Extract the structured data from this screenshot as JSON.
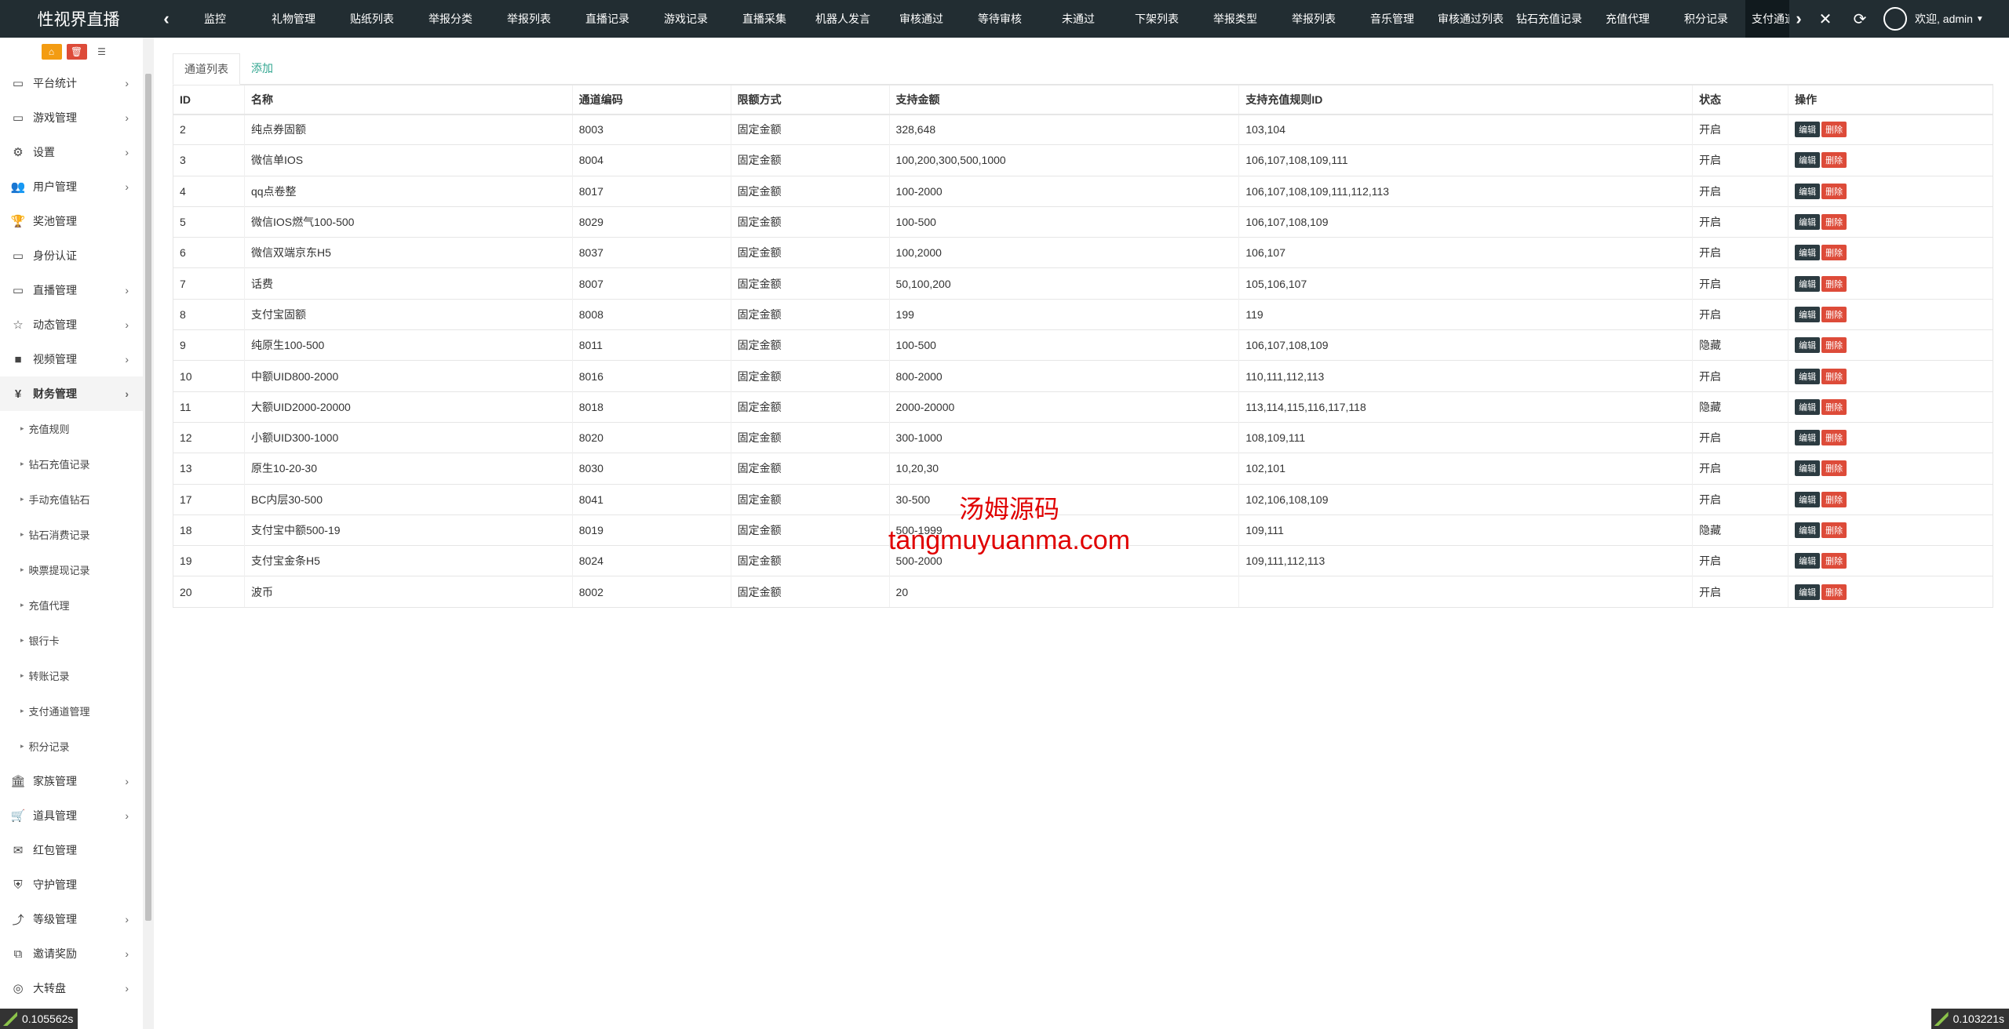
{
  "topbar": {
    "brand": "性视界直播",
    "tabs": [
      "监控",
      "礼物管理",
      "贴纸列表",
      "举报分类",
      "举报列表",
      "直播记录",
      "游戏记录",
      "直播采集",
      "机器人发言",
      "审核通过",
      "等待审核",
      "未通过",
      "下架列表",
      "举报类型",
      "举报列表",
      "音乐管理",
      "审核通过列表",
      "钻石充值记录",
      "充值代理",
      "积分记录",
      "支付通道管理"
    ],
    "active_tab_index": 20,
    "welcome": "欢迎, admin"
  },
  "sidebar": {
    "items": [
      {
        "label": "平台统计",
        "icon": "monitor-icon",
        "glyph": "▭",
        "chev": true
      },
      {
        "label": "游戏管理",
        "icon": "monitor-icon",
        "glyph": "▭",
        "chev": true
      },
      {
        "label": "设置",
        "icon": "cogs-icon",
        "glyph": "⚙",
        "chev": true
      },
      {
        "label": "用户管理",
        "icon": "users-icon",
        "glyph": "👥",
        "chev": true
      },
      {
        "label": "奖池管理",
        "icon": "trophy-icon",
        "glyph": "🏆",
        "chev": false
      },
      {
        "label": "身份认证",
        "icon": "monitor-icon",
        "glyph": "▭",
        "chev": false
      },
      {
        "label": "直播管理",
        "icon": "monitor-icon",
        "glyph": "▭",
        "chev": true
      },
      {
        "label": "动态管理",
        "icon": "star-icon",
        "glyph": "☆",
        "chev": true
      },
      {
        "label": "视频管理",
        "icon": "video-icon",
        "glyph": "■",
        "chev": true
      },
      {
        "label": "财务管理",
        "icon": "yen-icon",
        "glyph": "¥",
        "chev": true,
        "expanded": true
      }
    ],
    "sub_items": [
      "充值规则",
      "钻石充值记录",
      "手动充值钻石",
      "钻石消费记录",
      "映票提现记录",
      "充值代理",
      "银行卡",
      "转账记录",
      "支付通道管理",
      "积分记录"
    ],
    "items_after": [
      {
        "label": "家族管理",
        "icon": "bank-icon",
        "glyph": "🏛",
        "chev": true
      },
      {
        "label": "道具管理",
        "icon": "cart-icon",
        "glyph": "🛒",
        "chev": true
      },
      {
        "label": "红包管理",
        "icon": "envelope-icon",
        "glyph": "✉",
        "chev": false
      },
      {
        "label": "守护管理",
        "icon": "shield-icon",
        "glyph": "⛨",
        "chev": false
      },
      {
        "label": "等级管理",
        "icon": "level-icon",
        "glyph": "⤴",
        "chev": true
      },
      {
        "label": "邀请奖励",
        "icon": "sitemap-icon",
        "glyph": "⧉",
        "chev": true
      },
      {
        "label": "大转盘",
        "icon": "gamepad-icon",
        "glyph": "◎",
        "chev": true
      }
    ]
  },
  "subtabs": {
    "list": "通道列表",
    "add": "添加"
  },
  "table": {
    "headers": [
      "ID",
      "名称",
      "通道编码",
      "限额方式",
      "支持金额",
      "支持充值规则ID",
      "状态",
      "操作"
    ],
    "edit_label": "编辑",
    "delete_label": "删除",
    "rows": [
      [
        "2",
        "纯点券固额",
        "8003",
        "固定金额",
        "328,648",
        "103,104",
        "开启"
      ],
      [
        "3",
        "微信单IOS",
        "8004",
        "固定金额",
        "100,200,300,500,1000",
        "106,107,108,109,111",
        "开启"
      ],
      [
        "4",
        "qq点卷整",
        "8017",
        "固定金额",
        "100-2000",
        "106,107,108,109,111,112,113",
        "开启"
      ],
      [
        "5",
        "微信IOS燃气100-500",
        "8029",
        "固定金额",
        "100-500",
        "106,107,108,109",
        "开启"
      ],
      [
        "6",
        "微信双端京东H5",
        "8037",
        "固定金额",
        "100,2000",
        "106,107",
        "开启"
      ],
      [
        "7",
        "话费",
        "8007",
        "固定金额",
        "50,100,200",
        "105,106,107",
        "开启"
      ],
      [
        "8",
        "支付宝固额",
        "8008",
        "固定金额",
        "199",
        "119",
        "开启"
      ],
      [
        "9",
        "纯原生100-500",
        "8011",
        "固定金额",
        "100-500",
        "106,107,108,109",
        "隐藏"
      ],
      [
        "10",
        "中额UID800-2000",
        "8016",
        "固定金额",
        "800-2000",
        "110,111,112,113",
        "开启"
      ],
      [
        "11",
        "大额UID2000-20000",
        "8018",
        "固定金额",
        "2000-20000",
        "113,114,115,116,117,118",
        "隐藏"
      ],
      [
        "12",
        "小额UID300-1000",
        "8020",
        "固定金额",
        "300-1000",
        "108,109,111",
        "开启"
      ],
      [
        "13",
        "原生10-20-30",
        "8030",
        "固定金额",
        "10,20,30",
        "102,101",
        "开启"
      ],
      [
        "17",
        "BC内层30-500",
        "8041",
        "固定金额",
        "30-500",
        "102,106,108,109",
        "开启"
      ],
      [
        "18",
        "支付宝中额500-19",
        "8019",
        "固定金额",
        "500-1999",
        "109,111",
        "隐藏"
      ],
      [
        "19",
        "支付宝金条H5",
        "8024",
        "固定金额",
        "500-2000",
        "109,111,112,113",
        "开启"
      ],
      [
        "20",
        "波币",
        "8002",
        "固定金额",
        "20",
        "",
        "开启"
      ]
    ]
  },
  "watermark": {
    "line1": "汤姆源码",
    "line2": "tangmuyuanma.com"
  },
  "timers": {
    "left": "0.105562s",
    "right": "0.103221s"
  }
}
